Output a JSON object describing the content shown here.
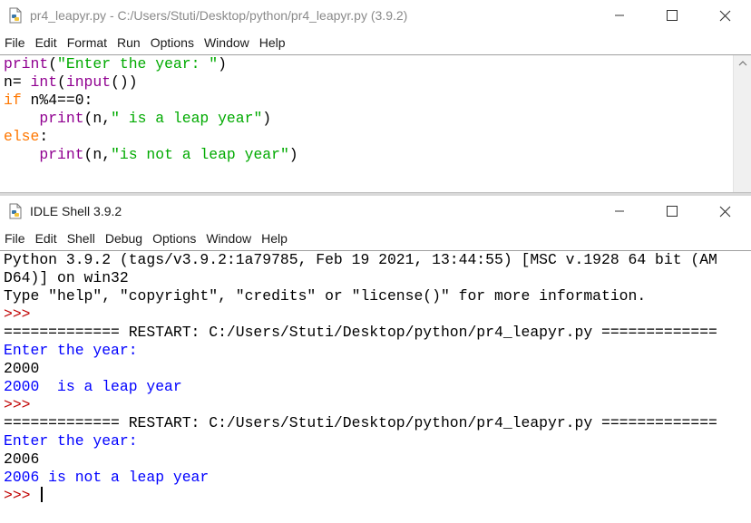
{
  "editor": {
    "title": "pr4_leapyr.py - C:/Users/Stuti/Desktop/python/pr4_leapyr.py (3.9.2)",
    "menu": [
      "File",
      "Edit",
      "Format",
      "Run",
      "Options",
      "Window",
      "Help"
    ],
    "code": [
      [
        {
          "c": "b",
          "t": "print"
        },
        {
          "c": "t",
          "t": "("
        },
        {
          "c": "s",
          "t": "\"Enter the year: \""
        },
        {
          "c": "t",
          "t": ")"
        }
      ],
      [
        {
          "c": "t",
          "t": "n= "
        },
        {
          "c": "b",
          "t": "int"
        },
        {
          "c": "t",
          "t": "("
        },
        {
          "c": "b",
          "t": "input"
        },
        {
          "c": "t",
          "t": "())"
        }
      ],
      [
        {
          "c": "k",
          "t": "if"
        },
        {
          "c": "t",
          "t": " n%4==0:"
        }
      ],
      [
        {
          "c": "t",
          "t": "    "
        },
        {
          "c": "b",
          "t": "print"
        },
        {
          "c": "t",
          "t": "(n,"
        },
        {
          "c": "s",
          "t": "\" is a leap year\""
        },
        {
          "c": "t",
          "t": ")"
        }
      ],
      [
        {
          "c": "k",
          "t": "else"
        },
        {
          "c": "t",
          "t": ":"
        }
      ],
      [
        {
          "c": "t",
          "t": "    "
        },
        {
          "c": "b",
          "t": "print"
        },
        {
          "c": "t",
          "t": "(n,"
        },
        {
          "c": "s",
          "t": "\"is not a leap year\""
        },
        {
          "c": "t",
          "t": ")"
        }
      ]
    ]
  },
  "shell": {
    "title": "IDLE Shell 3.9.2",
    "menu": [
      "File",
      "Edit",
      "Shell",
      "Debug",
      "Options",
      "Window",
      "Help"
    ],
    "lines": [
      {
        "c": "plain",
        "t": "Python 3.9.2 (tags/v3.9.2:1a79785, Feb 19 2021, 13:44:55) [MSC v.1928 64 bit (AM"
      },
      {
        "c": "plain",
        "t": "D64)] on win32"
      },
      {
        "c": "plain",
        "t": "Type \"help\", \"copyright\", \"credits\" or \"license()\" for more information."
      },
      {
        "c": "prompt",
        "t": ">>> "
      },
      {
        "c": "plain",
        "t": "============= RESTART: C:/Users/Stuti/Desktop/python/pr4_leapyr.py ============="
      },
      {
        "c": "out",
        "t": "Enter the year: "
      },
      {
        "c": "plain",
        "t": "2000"
      },
      {
        "c": "out",
        "t": "2000  is a leap year"
      },
      {
        "c": "prompt",
        "t": ">>> "
      },
      {
        "c": "plain",
        "t": "============= RESTART: C:/Users/Stuti/Desktop/python/pr4_leapyr.py ============="
      },
      {
        "c": "out",
        "t": "Enter the year: "
      },
      {
        "c": "plain",
        "t": "2006"
      },
      {
        "c": "out",
        "t": "2006 is not a leap year"
      }
    ],
    "current_prompt": ">>> "
  },
  "colors": {
    "keyword": "#ff7700",
    "builtin": "#900090",
    "string": "#00aa00",
    "output": "#0000ff",
    "prompt": "#c00000"
  }
}
